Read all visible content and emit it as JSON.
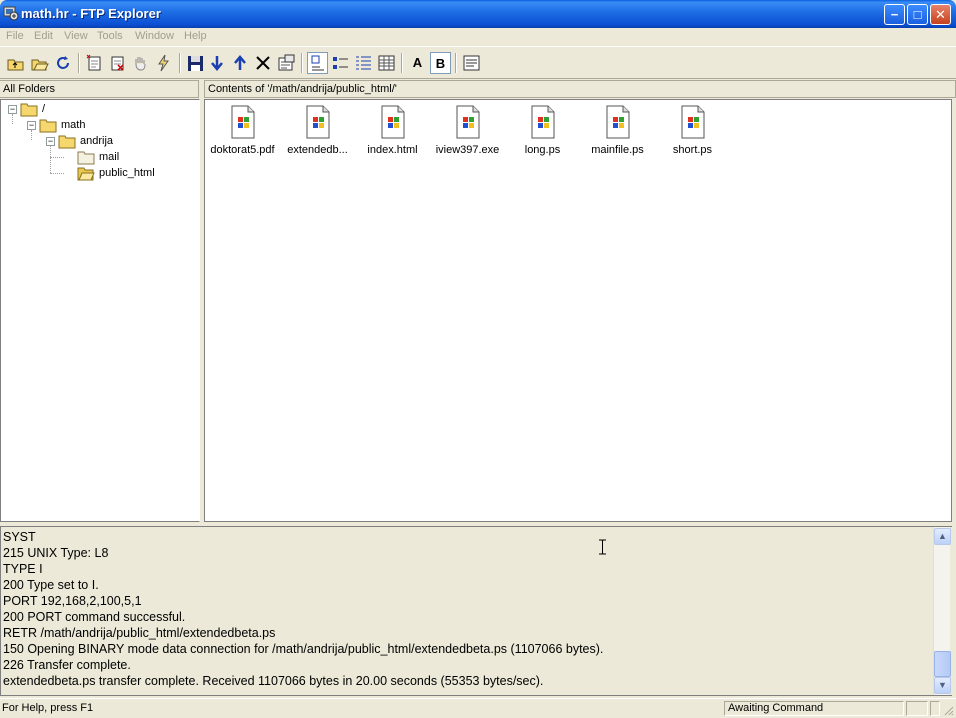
{
  "window": {
    "title": "math.hr - FTP Explorer",
    "buttons": {
      "minimize": "−",
      "maximize": "□",
      "close": "✕"
    }
  },
  "menu": [
    "File",
    "Edit",
    "View",
    "Tools",
    "Window",
    "Help"
  ],
  "toolbar": {
    "icons": [
      "up-folder-icon",
      "open-folder-icon",
      "refresh-icon",
      "new-folder-icon",
      "delete-folder-icon",
      "hand-icon",
      "connect-icon",
      "save-icon",
      "download-icon",
      "upload-icon",
      "delete-icon",
      "properties-icon",
      "large-icons-view-icon",
      "small-icons-view-icon",
      "list-view-icon",
      "details-view-icon",
      "ascii-mode",
      "binary-mode",
      "log-view-icon"
    ],
    "ascii_label": "A",
    "binary_label": "B"
  },
  "folders": {
    "header": "All Folders",
    "tree": [
      {
        "label": "/",
        "level": 0
      },
      {
        "label": "math",
        "level": 1
      },
      {
        "label": "andrija",
        "level": 2
      },
      {
        "label": "mail",
        "level": 3
      },
      {
        "label": "public_html",
        "level": 3,
        "open": true
      }
    ]
  },
  "contents": {
    "header": "Contents of '/math/andrija/public_html/'",
    "files": [
      {
        "name": "doktorat5.pdf"
      },
      {
        "name": "extendedb..."
      },
      {
        "name": "index.html"
      },
      {
        "name": "iview397.exe"
      },
      {
        "name": "long.ps"
      },
      {
        "name": "mainfile.ps"
      },
      {
        "name": "short.ps"
      }
    ]
  },
  "log": {
    "lines": [
      "SYST",
      "215 UNIX Type: L8",
      "TYPE I",
      "200 Type set to I.",
      "PORT 192,168,2,100,5,1",
      "200 PORT command successful.",
      "RETR /math/andrija/public_html/extendedbeta.ps",
      "150 Opening BINARY mode data connection for /math/andrija/public_html/extendedbeta.ps (1107066 bytes).",
      "226 Transfer complete.",
      "extendedbeta.ps transfer complete.  Received 1107066 bytes in 20.00 seconds (55353 bytes/sec)."
    ],
    "scroll_up": "▲",
    "scroll_down": "▼"
  },
  "status": {
    "help": "For Help, press F1",
    "state": "Awaiting Command",
    "panel3": "",
    "panel4": ""
  },
  "colors": {
    "titlebar": "#0b4fd2",
    "panel": "#ece9d8",
    "disabled_menu": "#a39e8f"
  }
}
